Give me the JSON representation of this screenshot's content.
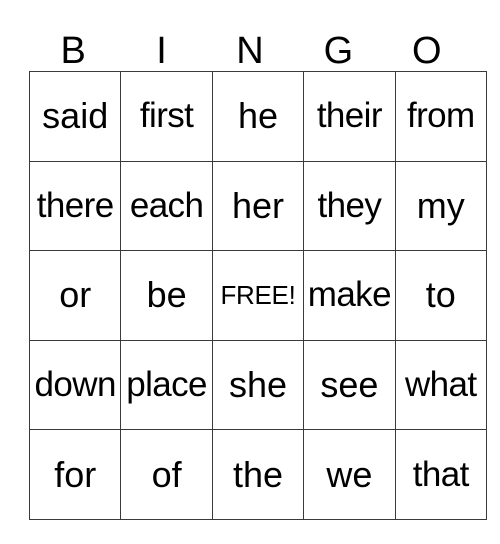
{
  "card": {
    "title": "BINGO",
    "header_letters": [
      "B",
      "I",
      "N",
      "G",
      "O"
    ],
    "grid_size": "5x5",
    "free_space": {
      "label": "FREE!",
      "row": 3,
      "column": 3
    },
    "colors": {
      "background": "#ffffff",
      "text": "#000000",
      "grid_line": "#3a3a3a"
    },
    "rows": [
      {
        "cells": [
          {
            "word": "said",
            "size": "normal",
            "marked": false
          },
          {
            "word": "first",
            "size": "long",
            "marked": false
          },
          {
            "word": "he",
            "size": "normal",
            "marked": false
          },
          {
            "word": "their",
            "size": "long",
            "marked": false
          },
          {
            "word": "from",
            "size": "long",
            "marked": false
          }
        ]
      },
      {
        "cells": [
          {
            "word": "there",
            "size": "long",
            "marked": false
          },
          {
            "word": "each",
            "size": "long",
            "marked": false
          },
          {
            "word": "her",
            "size": "normal",
            "marked": false
          },
          {
            "word": "they",
            "size": "long",
            "marked": false
          },
          {
            "word": "my",
            "size": "normal",
            "marked": false
          }
        ]
      },
      {
        "cells": [
          {
            "word": "or",
            "size": "normal",
            "marked": false
          },
          {
            "word": "be",
            "size": "normal",
            "marked": false
          },
          {
            "word": "FREE!",
            "size": "free",
            "marked": true
          },
          {
            "word": "make",
            "size": "long",
            "marked": false
          },
          {
            "word": "to",
            "size": "normal",
            "marked": false
          }
        ]
      },
      {
        "cells": [
          {
            "word": "down",
            "size": "long",
            "marked": false
          },
          {
            "word": "place",
            "size": "long",
            "marked": false
          },
          {
            "word": "she",
            "size": "normal",
            "marked": false
          },
          {
            "word": "see",
            "size": "normal",
            "marked": false
          },
          {
            "word": "what",
            "size": "long",
            "marked": false
          }
        ]
      },
      {
        "cells": [
          {
            "word": "for",
            "size": "normal",
            "marked": false
          },
          {
            "word": "of",
            "size": "normal",
            "marked": false
          },
          {
            "word": "the",
            "size": "normal",
            "marked": false
          },
          {
            "word": "we",
            "size": "normal",
            "marked": false
          },
          {
            "word": "that",
            "size": "long",
            "marked": false
          }
        ]
      }
    ]
  }
}
